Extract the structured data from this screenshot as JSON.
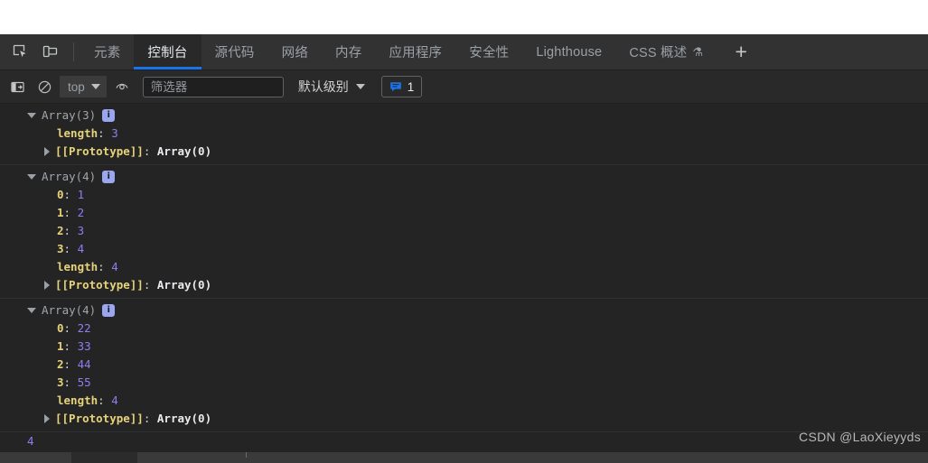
{
  "devtools": {
    "tabs": [
      {
        "label": "元素",
        "active": false
      },
      {
        "label": "控制台",
        "active": true
      },
      {
        "label": "源代码",
        "active": false
      },
      {
        "label": "网络",
        "active": false
      },
      {
        "label": "内存",
        "active": false
      },
      {
        "label": "应用程序",
        "active": false
      },
      {
        "label": "安全性",
        "active": false
      },
      {
        "label": "Lighthouse",
        "active": false
      },
      {
        "label": "CSS 概述",
        "active": false,
        "flask": "⚗"
      }
    ],
    "add_tab_label": "+",
    "icons": {
      "inspect": "inspect-element-icon",
      "device": "device-toolbar-icon",
      "sidebar": "console-sidebar-icon",
      "clear": "clear-console-icon",
      "eye": "live-expression-icon"
    },
    "accent_color": "#1a73e8",
    "active_tab_bg": "#292929",
    "tabstrip_bg": "#323232",
    "body_bg": "#242424"
  },
  "console_toolbar": {
    "context_value": "top",
    "filter": {
      "value": "",
      "placeholder": "筛选器"
    },
    "level_label": "默认级别",
    "message_count": "1"
  },
  "console_logs": [
    {
      "header": "Array(3)",
      "info": "i",
      "props": [
        {
          "key": "length",
          "value": "3",
          "type": "number"
        }
      ],
      "proto": {
        "key": "[[Prototype]]",
        "value": "Array(0)"
      }
    },
    {
      "header": "Array(4)",
      "info": "i",
      "props": [
        {
          "key": "0",
          "value": "1",
          "type": "number"
        },
        {
          "key": "1",
          "value": "2",
          "type": "number"
        },
        {
          "key": "2",
          "value": "3",
          "type": "number"
        },
        {
          "key": "3",
          "value": "4",
          "type": "number"
        },
        {
          "key": "length",
          "value": "4",
          "type": "number"
        }
      ],
      "proto": {
        "key": "[[Prototype]]",
        "value": "Array(0)"
      }
    },
    {
      "header": "Array(4)",
      "info": "i",
      "props": [
        {
          "key": "0",
          "value": "22",
          "type": "number"
        },
        {
          "key": "1",
          "value": "33",
          "type": "number"
        },
        {
          "key": "2",
          "value": "44",
          "type": "number"
        },
        {
          "key": "3",
          "value": "55",
          "type": "number"
        },
        {
          "key": "length",
          "value": "4",
          "type": "number"
        }
      ],
      "proto": {
        "key": "[[Prototype]]",
        "value": "Array(0)"
      }
    }
  ],
  "console_prompt_partial": "4",
  "watermark": "CSDN @LaoXieyyds",
  "colors": {
    "number": "#8d7ff0",
    "key": "#e6d37a",
    "class": "#a0a6ac",
    "info_badge_bg": "#9aa6f0",
    "tab_active_underline": "#1a73e8"
  }
}
